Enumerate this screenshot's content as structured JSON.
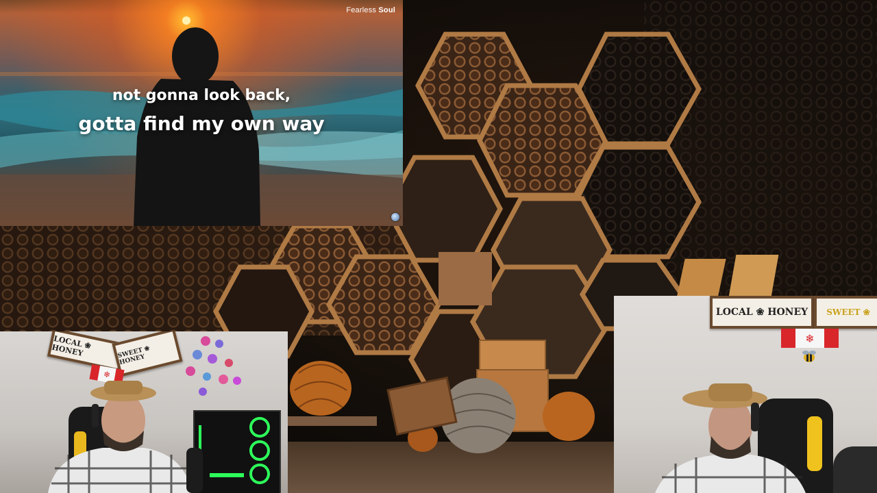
{
  "lyric_video": {
    "brand_prefix": "Fearless",
    "brand_suffix": "Soul",
    "line1": "not gonna look back,",
    "line2": "gotta find my own way"
  },
  "webcam_left": {
    "sign_local_honey": "LOCAL ❀ HONEY",
    "sign_sweet_honey": "SWEET ❀ HONEY"
  },
  "webcam_right": {
    "sign_local_honey": "LOCAL ❀ HONEY",
    "sign_sweet": "SWEET ❀"
  },
  "colors": {
    "sunset_orange": "#ff9a2e",
    "honeycomb_wood": "#b07a45",
    "flag_red": "#d8262b"
  }
}
